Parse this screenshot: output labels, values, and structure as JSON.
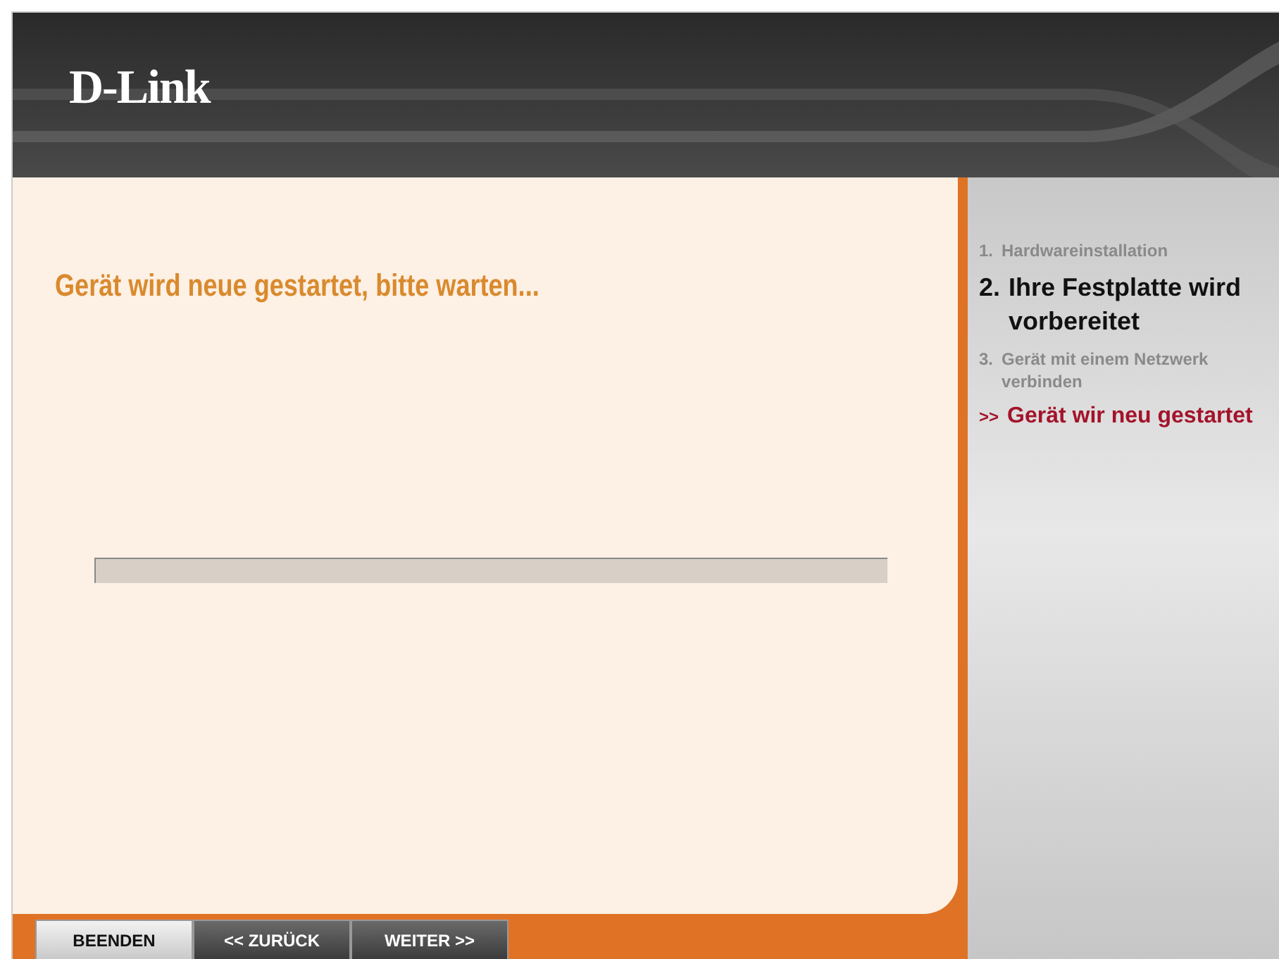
{
  "header": {
    "logo": "D-Link"
  },
  "main": {
    "heading": "Gerät wird neue gestartet, bitte warten...",
    "progress": {
      "level": 0
    }
  },
  "steps": [
    {
      "number": "1.",
      "label": "Hardwareinstallation",
      "kind": "done"
    },
    {
      "number": "2.",
      "label": "Ihre Festplatte wird vorbereitet",
      "kind": "current"
    },
    {
      "number": "3.",
      "label": "Gerät mit einem Netzwerk verbinden",
      "kind": "pending"
    },
    {
      "marker": ">>",
      "label": "Gerät wir neu gestartet",
      "kind": "active"
    }
  ],
  "buttons": [
    {
      "label": "BEENDEN",
      "kind": "light"
    },
    {
      "label": "<< ZURÜCK",
      "kind": "dark"
    },
    {
      "label": "WEITER >>",
      "kind": "dark"
    }
  ]
}
